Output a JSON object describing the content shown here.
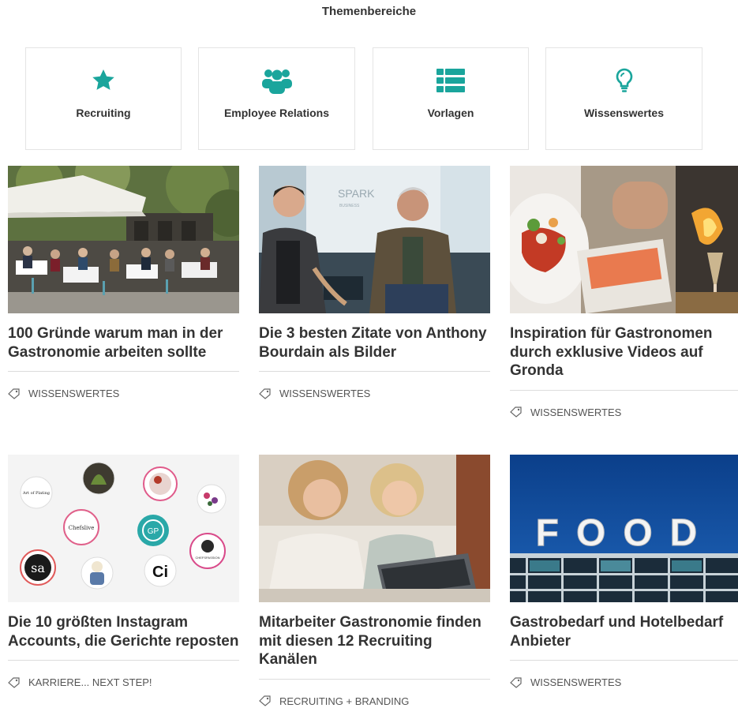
{
  "section": {
    "title": "Themenbereiche"
  },
  "categories": [
    {
      "label": "Recruiting",
      "icon": "star-icon"
    },
    {
      "label": "Employee Relations",
      "icon": "users-icon"
    },
    {
      "label": "Vorlagen",
      "icon": "list-icon"
    },
    {
      "label": "Wissenswertes",
      "icon": "lightbulb-icon"
    }
  ],
  "accent_color": "#1aa59c",
  "articles": [
    {
      "title": "100 Gründe warum man in der Gastronomie arbeiten sollte",
      "tag": "WISSENSWERTES",
      "image": "cafe-terrace-photo"
    },
    {
      "title": "Die 3 besten Zitate von Anthony Bourdain als Bilder",
      "tag": "WISSENSWERTES",
      "image": "interview-photo",
      "image_text": {
        "line1": "SPARK",
        "line2": "BUSINESS"
      }
    },
    {
      "title": "Inspiration für Gastronomen durch exklusive Videos auf Gronda",
      "tag": "WISSENSWERTES",
      "image": "plated-food-photo"
    },
    {
      "title": "Die 10 größten Instagram Accounts, die Gerichte reposten",
      "tag": "KARRIERE... NEXT STEP!",
      "image": "instagram-collage",
      "image_text": {
        "art": "Art of Plating",
        "chef": "Chefslive",
        "ci": "Ci",
        "gp": "GP",
        "cp": "CHEFSPASSION",
        "sa": "sa"
      }
    },
    {
      "title": "Mitarbeiter Gastronomie finden mit diesen 12 Recruiting Kanälen",
      "tag": "RECRUITING + BRANDING",
      "image": "team-laptop-photo"
    },
    {
      "title": "Gastrobedarf und Hotelbedarf Anbieter",
      "tag": "WISSENSWERTES",
      "image": "food-sign-photo",
      "image_text": {
        "sign": "FOOD"
      }
    }
  ]
}
